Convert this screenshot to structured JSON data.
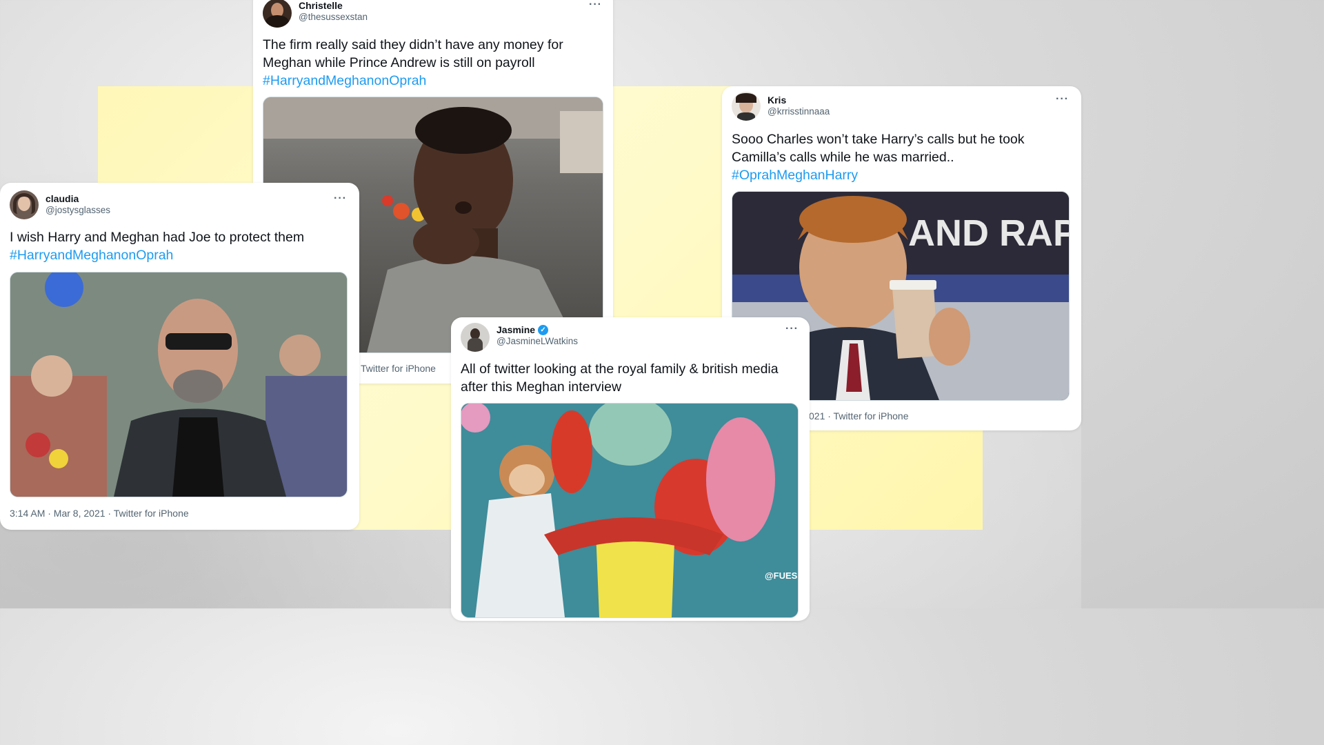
{
  "tweets": {
    "christelle": {
      "display_name": "Christelle",
      "handle": "@thesussexstan",
      "more": "···",
      "text_line1": "The firm really said they didn’t have any money for",
      "text_line2": "Meghan while Prince  Andrew is still on payroll",
      "hashtag": "#HarryandMeghanonOprah",
      "meta": "Twitter for iPhone"
    },
    "claudia": {
      "display_name": "claudia",
      "handle": "@jostysglasses",
      "more": "···",
      "text_line1": "I wish Harry and Meghan had Joe to protect them",
      "hashtag": "#HarryandMeghanonOprah",
      "meta": "3:14 AM · Mar 8, 2021 · Twitter for iPhone"
    },
    "kris": {
      "display_name": "Kris",
      "handle": "@krrisstinnaaa",
      "more": "···",
      "text_line1": "Sooo Charles won’t take Harry’s calls but he took",
      "text_line2": "Camilla’s calls while he was married..",
      "hashtag": "#OprahMeghanHarry",
      "meta": "021 · Twitter for iPhone",
      "image_sign_text": "AND RAPI"
    },
    "jasmine": {
      "display_name": "Jasmine",
      "handle": "@JasmineLWatkins",
      "more": "···",
      "verified_icon": "✓",
      "text_line1": "All of twitter looking at the royal family & british media",
      "text_line2": "after this Meghan interview",
      "watermark": "@FUESIN"
    }
  },
  "colors": {
    "hashtag": "#1d9bf0",
    "text": "#0f1419",
    "secondary": "#536471",
    "yellow": "#fff7b8"
  }
}
